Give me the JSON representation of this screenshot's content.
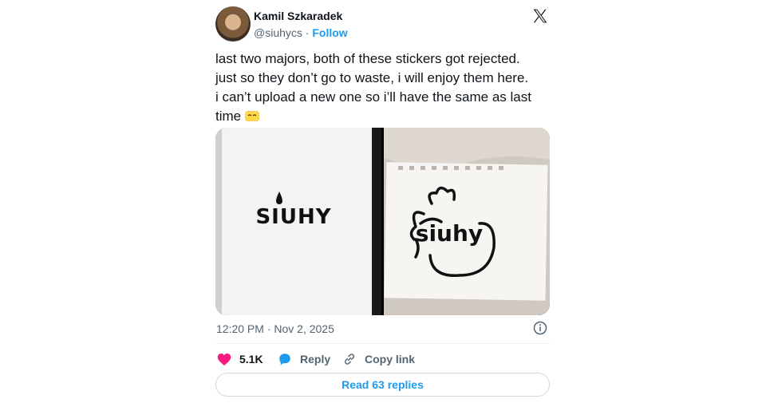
{
  "author": {
    "name": "Kamil Szkaradek",
    "handle": "@siuhycs",
    "separator": " · ",
    "follow_label": "Follow"
  },
  "tweet": {
    "lines": [
      "last two majors, both of these stickers got rejected.",
      "just so they don’t go to waste, i will enjoy them here.",
      "i can’t upload a new one so i’ll have the same as last",
      "time "
    ],
    "emoji_icon": "sleepy-eyes-emoji-icon"
  },
  "media": {
    "left_text": "SIUHY",
    "right_text": "siuhy"
  },
  "meta": {
    "timestamp": "12:20 PM · Nov 2, 2025"
  },
  "actions": {
    "likes": "5.1K",
    "reply_label": "Reply",
    "copy_label": "Copy link"
  },
  "footer": {
    "read_replies": "Read 63 replies"
  },
  "colors": {
    "accent": "#1d9bf0",
    "like": "#f91880",
    "muted": "#536471"
  }
}
